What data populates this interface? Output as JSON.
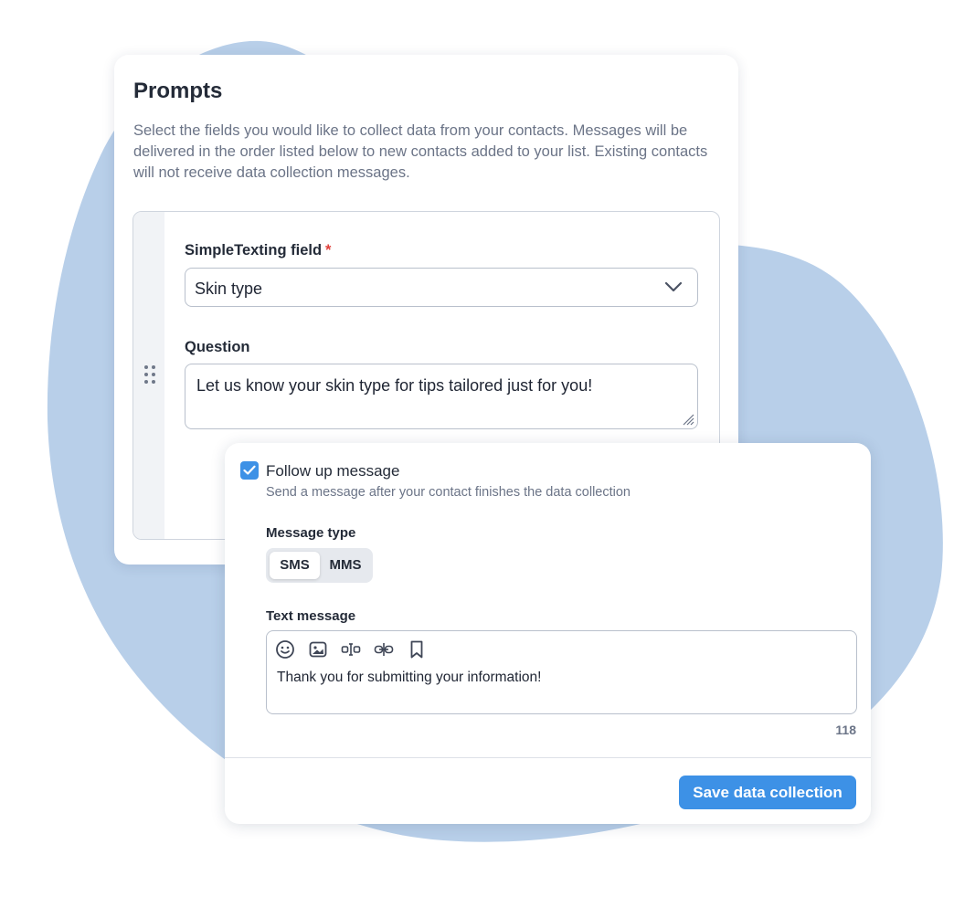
{
  "colors": {
    "blob": "#b8cfe9",
    "accent": "#3d91e6",
    "required": "#e0413b"
  },
  "prompts": {
    "title": "Prompts",
    "description": "Select the fields you would like to collect data from your contacts. Messages will be delivered in the order listed below to new contacts added to your list. Existing contacts will not receive data collection messages.",
    "field_label": "SimpleTexting field",
    "required_marker": "*",
    "field_value": "Skin type",
    "question_label": "Question",
    "question_value": "Let us know your skin type for tips tailored just for you!"
  },
  "followup": {
    "checked": true,
    "label": "Follow up message",
    "description": "Send a message after your contact finishes the data collection",
    "type_label": "Message type",
    "types": [
      {
        "label": "SMS",
        "active": true
      },
      {
        "label": "MMS",
        "active": false
      }
    ],
    "text_label": "Text message",
    "toolbar_icons": [
      "emoji-icon",
      "image-icon",
      "text-field-icon",
      "link-icon",
      "bookmark-icon"
    ],
    "message_value": "Thank you for submitting your information!",
    "char_count": "118",
    "save_label": "Save data collection"
  }
}
